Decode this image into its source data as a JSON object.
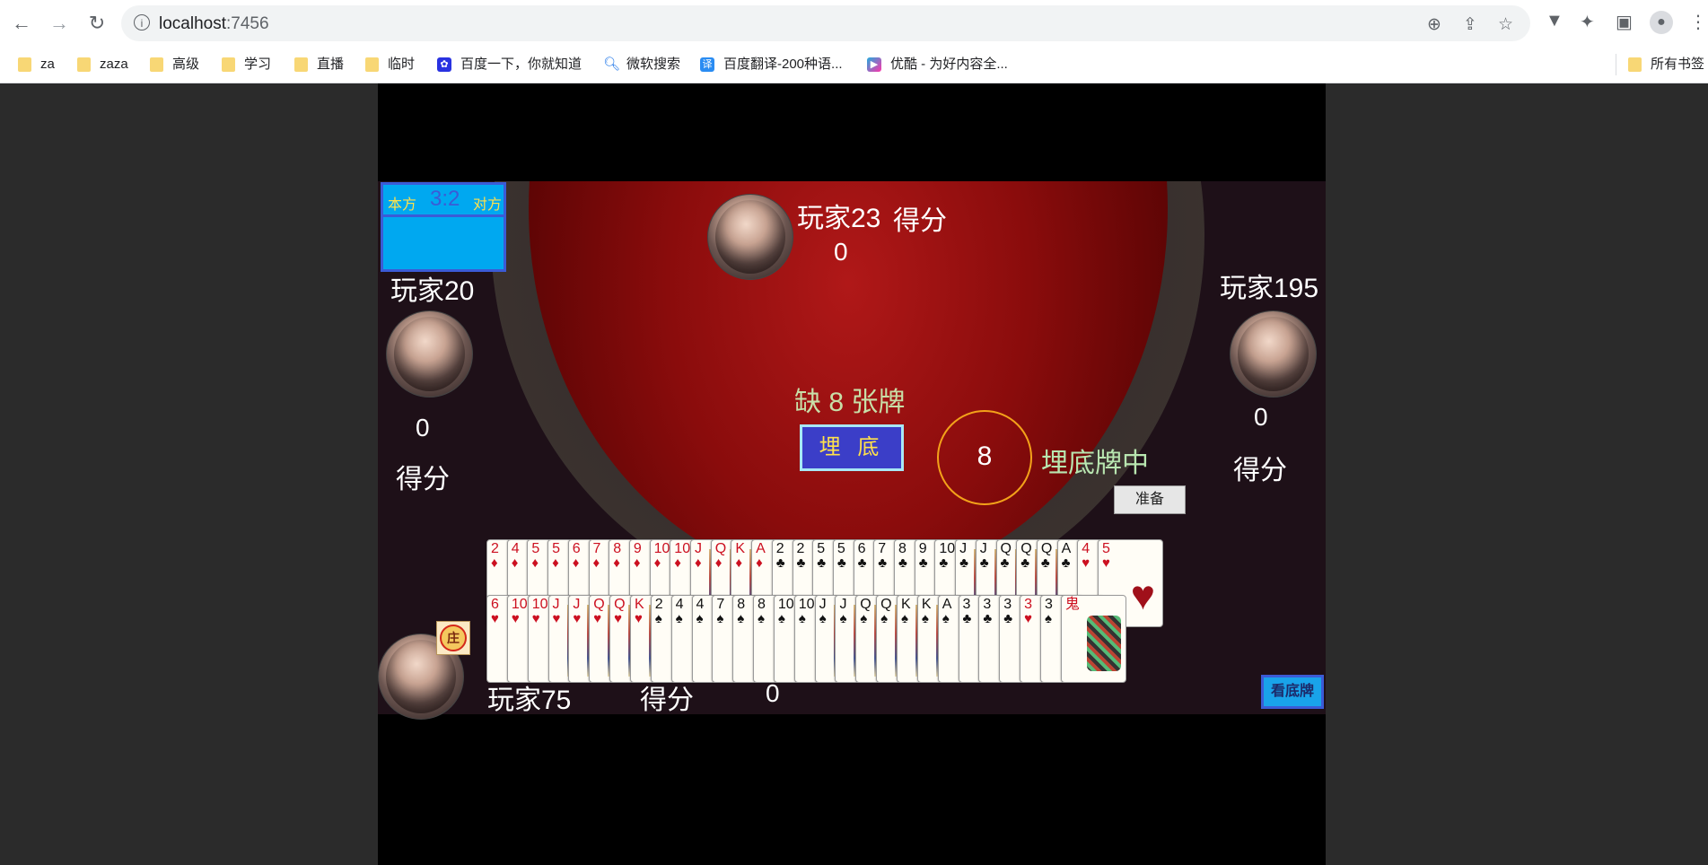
{
  "browser": {
    "url_host": "localhost",
    "url_port": ":7456",
    "bookmarks": [
      {
        "label": "za",
        "type": "folder"
      },
      {
        "label": "zaza",
        "type": "folder"
      },
      {
        "label": "高级",
        "type": "folder"
      },
      {
        "label": "学习",
        "type": "folder"
      },
      {
        "label": "直播",
        "type": "folder"
      },
      {
        "label": "临时",
        "type": "folder"
      },
      {
        "label": "百度一下，你就知道",
        "type": "link"
      },
      {
        "label": "微软搜索",
        "type": "link"
      },
      {
        "label": "百度翻译-200种语...",
        "type": "link"
      },
      {
        "label": "优酷 - 为好内容全...",
        "type": "link"
      }
    ],
    "all_bookmarks": "所有书签",
    "icons": {
      "back": "arrow-left-icon",
      "forward": "arrow-right-icon",
      "reload": "reload-icon",
      "info": "info-icon",
      "zoom": "zoom-icon",
      "share": "share-icon",
      "star": "star-icon",
      "extension": "puzzle-icon",
      "sidepanel": "side-panel-icon",
      "profile": "profile-icon",
      "menu": "kebab-menu-icon"
    }
  },
  "game": {
    "score_panel": {
      "our_label": "本方",
      "score": "3:2",
      "their_label": "对方"
    },
    "players": {
      "top": {
        "name": "玩家23",
        "score_label": "得分",
        "score": "0"
      },
      "left": {
        "name": "玩家20",
        "score_label": "得分",
        "score": "0"
      },
      "right": {
        "name": "玩家195",
        "score_label": "得分",
        "score": "0"
      },
      "bottom": {
        "name": "玩家75",
        "score_label": "得分",
        "score": "0",
        "dealer_badge": "庄"
      }
    },
    "missing_cards": "缺 8 张牌",
    "bury_button": "埋 底",
    "timer": "8",
    "status_text": "埋底牌中",
    "ready_button": "准备",
    "view_bottom_button": "看底牌",
    "hand_row1": [
      {
        "r": "2",
        "s": "♦"
      },
      {
        "r": "4",
        "s": "♦"
      },
      {
        "r": "5",
        "s": "♦"
      },
      {
        "r": "5",
        "s": "♦"
      },
      {
        "r": "6",
        "s": "♦"
      },
      {
        "r": "7",
        "s": "♦"
      },
      {
        "r": "8",
        "s": "♦"
      },
      {
        "r": "9",
        "s": "♦"
      },
      {
        "r": "10",
        "s": "♦"
      },
      {
        "r": "10",
        "s": "♦"
      },
      {
        "r": "J",
        "s": "♦"
      },
      {
        "r": "Q",
        "s": "♦"
      },
      {
        "r": "K",
        "s": "♦"
      },
      {
        "r": "A",
        "s": "♦"
      },
      {
        "r": "2",
        "s": "♣"
      },
      {
        "r": "2",
        "s": "♣"
      },
      {
        "r": "5",
        "s": "♣"
      },
      {
        "r": "5",
        "s": "♣"
      },
      {
        "r": "6",
        "s": "♣"
      },
      {
        "r": "7",
        "s": "♣"
      },
      {
        "r": "8",
        "s": "♣"
      },
      {
        "r": "9",
        "s": "♣"
      },
      {
        "r": "10",
        "s": "♣"
      },
      {
        "r": "J",
        "s": "♣"
      },
      {
        "r": "J",
        "s": "♣"
      },
      {
        "r": "Q",
        "s": "♣"
      },
      {
        "r": "Q",
        "s": "♣"
      },
      {
        "r": "Q",
        "s": "♣"
      },
      {
        "r": "A",
        "s": "♣"
      },
      {
        "r": "4",
        "s": "♥"
      },
      {
        "r": "5",
        "s": "♥"
      }
    ],
    "hand_row2": [
      {
        "r": "6",
        "s": "♥"
      },
      {
        "r": "10",
        "s": "♥"
      },
      {
        "r": "10",
        "s": "♥"
      },
      {
        "r": "J",
        "s": "♥"
      },
      {
        "r": "J",
        "s": "♥"
      },
      {
        "r": "Q",
        "s": "♥"
      },
      {
        "r": "Q",
        "s": "♥"
      },
      {
        "r": "K",
        "s": "♥"
      },
      {
        "r": "2",
        "s": "♠"
      },
      {
        "r": "4",
        "s": "♠"
      },
      {
        "r": "4",
        "s": "♠"
      },
      {
        "r": "7",
        "s": "♠"
      },
      {
        "r": "8",
        "s": "♠"
      },
      {
        "r": "8",
        "s": "♠"
      },
      {
        "r": "10",
        "s": "♠"
      },
      {
        "r": "10",
        "s": "♠"
      },
      {
        "r": "J",
        "s": "♠"
      },
      {
        "r": "J",
        "s": "♠"
      },
      {
        "r": "Q",
        "s": "♠"
      },
      {
        "r": "Q",
        "s": "♠"
      },
      {
        "r": "K",
        "s": "♠"
      },
      {
        "r": "K",
        "s": "♠"
      },
      {
        "r": "A",
        "s": "♠"
      },
      {
        "r": "3",
        "s": "♣"
      },
      {
        "r": "3",
        "s": "♣"
      },
      {
        "r": "3",
        "s": "♣"
      },
      {
        "r": "3",
        "s": "♥"
      },
      {
        "r": "3",
        "s": "♠"
      },
      {
        "r": "鬼",
        "s": "joker"
      }
    ],
    "colors": {
      "red_suit": "#cc1020",
      "black_suit": "#111111",
      "score_panel": "#00a8f0",
      "button_blue": "#3b3ec8"
    }
  }
}
